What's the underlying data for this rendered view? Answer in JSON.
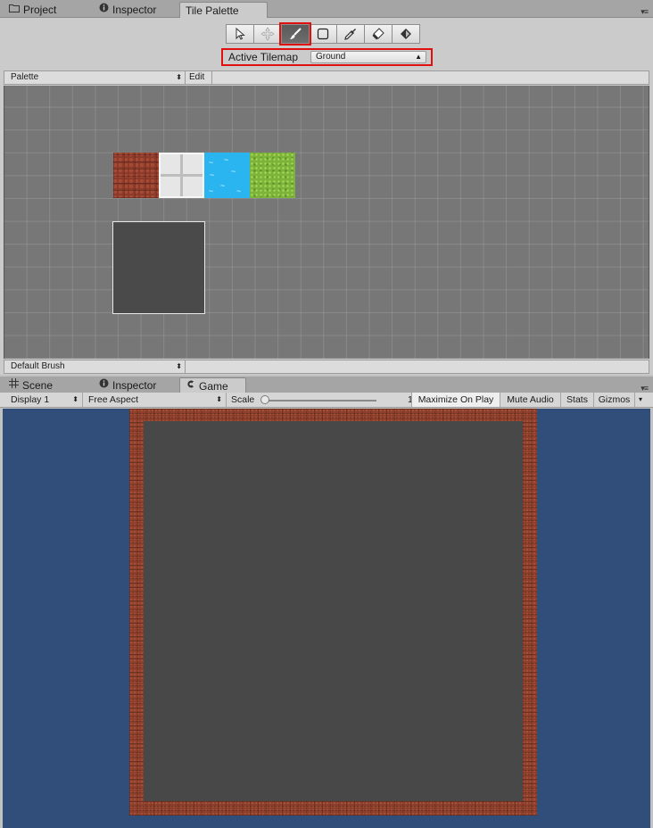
{
  "top_tabs": [
    {
      "label": "Project",
      "icon": "folder-icon"
    },
    {
      "label": "Inspector",
      "icon": "info-icon"
    },
    {
      "label": "Tile Palette",
      "icon": ""
    }
  ],
  "tools": [
    {
      "name": "select-tool",
      "selected": false
    },
    {
      "name": "move-tool",
      "selected": false
    },
    {
      "name": "paint-brush-tool",
      "selected": true
    },
    {
      "name": "box-fill-tool",
      "selected": false
    },
    {
      "name": "picker-tool",
      "selected": false
    },
    {
      "name": "eraser-tool",
      "selected": false
    },
    {
      "name": "flood-fill-tool",
      "selected": false
    }
  ],
  "active_tilemap": {
    "label": "Active Tilemap",
    "value": "Ground"
  },
  "palette": {
    "label": "Palette",
    "edit_label": "Edit"
  },
  "tiles": [
    "brick-tile",
    "stone-tile",
    "water-tile",
    "grass-tile"
  ],
  "brush": {
    "value": "Default Brush"
  },
  "bottom_tabs": [
    {
      "label": "Scene",
      "icon": "grid-icon"
    },
    {
      "label": "Inspector",
      "icon": "info-icon"
    },
    {
      "label": "Game",
      "icon": "game-icon"
    }
  ],
  "game_toolbar": {
    "display": "Display 1",
    "aspect": "Free Aspect",
    "scale_label": "Scale",
    "scale_value": "1x",
    "maximize": "Maximize On Play",
    "mute": "Mute Audio",
    "stats": "Stats",
    "gizmos": "Gizmos"
  },
  "colors": {
    "highlight": "#e01010",
    "game_background": "#314d79",
    "brick": "#8d3d2b",
    "floor": "#484848",
    "water": "#2ab5f0",
    "grass": "#7cb33a"
  }
}
